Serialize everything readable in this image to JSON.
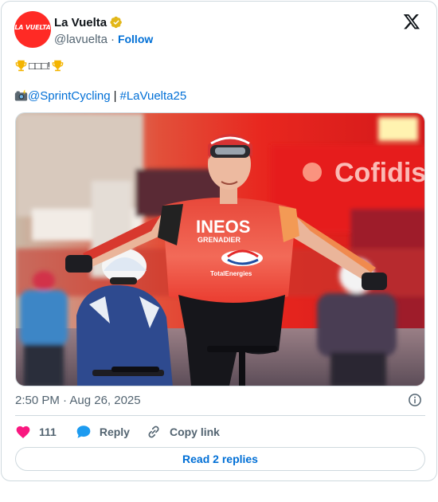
{
  "author": {
    "display_name": "La Vuelta",
    "handle": "@lavuelta",
    "follow_label": "Follow",
    "avatar_text": "LA VUELTA",
    "verified": true
  },
  "post": {
    "line1_glyphs": "□□□!",
    "mention": "@SprintCycling",
    "separator": "|",
    "hashtag": "#LaVuelta25",
    "timestamp": "2:50 PM · Aug 26, 2025"
  },
  "photo": {
    "billboard_text": "Cofidis",
    "jersey_text": "INEOS",
    "jersey_subtext": "GRENADIER",
    "sponsor_text": "TotalEnergies"
  },
  "actions": {
    "like_count": "111",
    "reply_label": "Reply",
    "copy_link_label": "Copy link",
    "read_replies_label": "Read 2 replies"
  },
  "icons": {
    "platform": "x-logo-icon",
    "verified": "verified-badge-icon",
    "trophy": "trophy-icon",
    "camera": "camera-flash-icon",
    "info": "info-icon",
    "like": "heart-icon",
    "reply": "reply-bubble-icon",
    "copy": "link-icon"
  },
  "colors": {
    "link": "#006fd6",
    "like": "#f91880",
    "reply": "#1d9bf0",
    "avatar_bg": "#ff2a25",
    "verified_gold": "#e2b719"
  }
}
